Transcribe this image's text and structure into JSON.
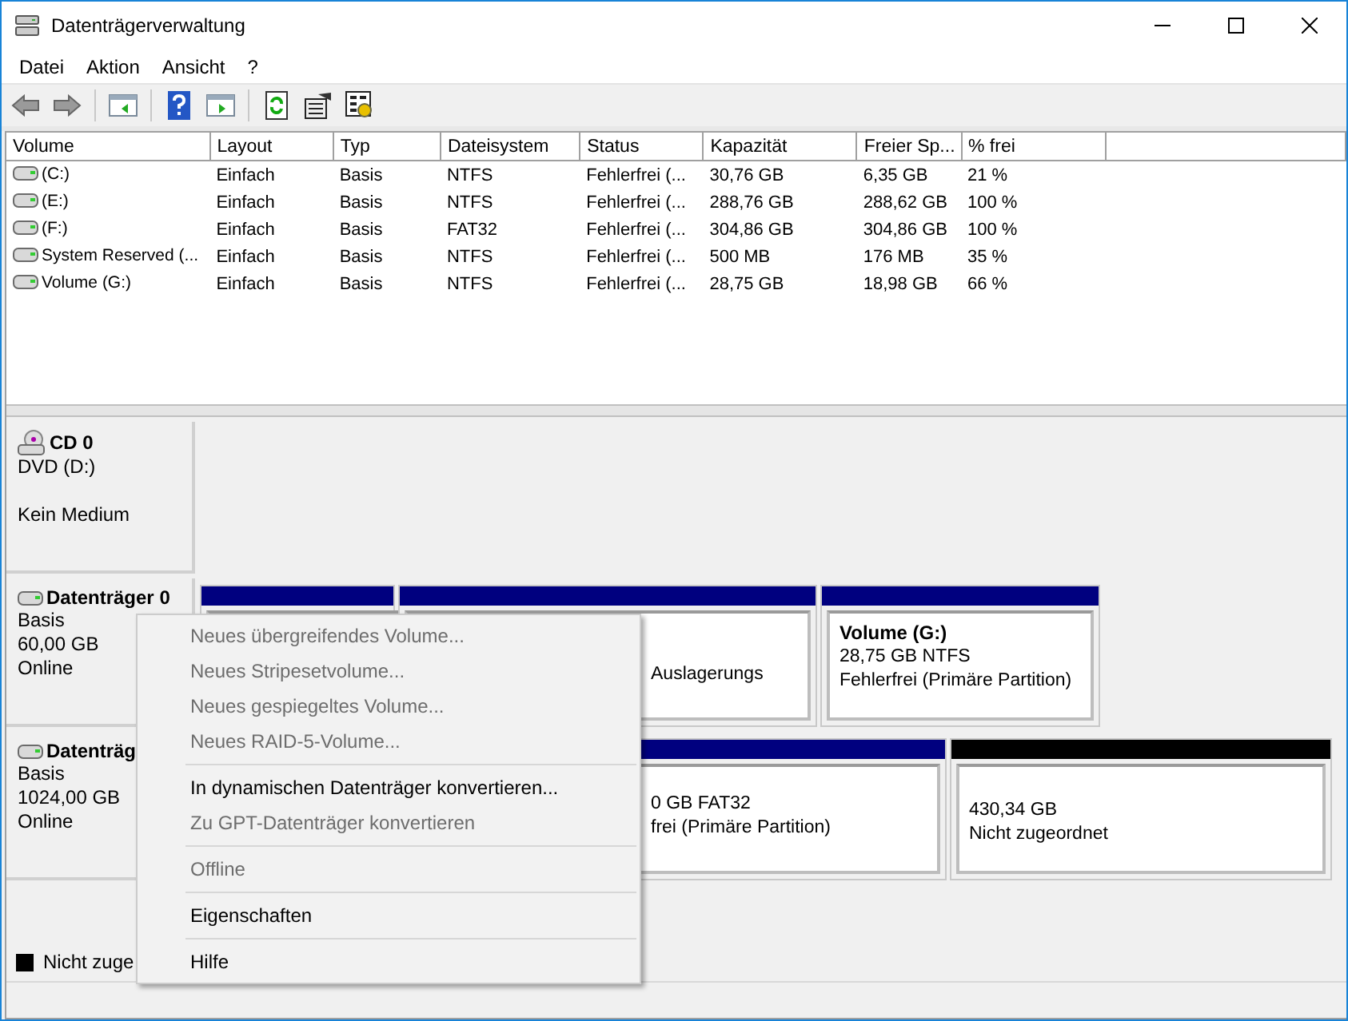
{
  "window": {
    "title": "Datenträgerverwaltung"
  },
  "menu_bar": [
    "Datei",
    "Aktion",
    "Ansicht",
    "?"
  ],
  "table": {
    "columns": [
      "Volume",
      "Layout",
      "Typ",
      "Dateisystem",
      "Status",
      "Kapazität",
      "Freier Sp...",
      "% frei"
    ],
    "rows": [
      {
        "cells": [
          "(C:)",
          "Einfach",
          "Basis",
          "NTFS",
          "Fehlerfrei (...",
          "30,76 GB",
          "6,35 GB",
          "21 %"
        ]
      },
      {
        "cells": [
          "(E:)",
          "Einfach",
          "Basis",
          "NTFS",
          "Fehlerfrei (...",
          "288,76 GB",
          "288,62 GB",
          "100 %"
        ]
      },
      {
        "cells": [
          "(F:)",
          "Einfach",
          "Basis",
          "FAT32",
          "Fehlerfrei (...",
          "304,86 GB",
          "304,86 GB",
          "100 %"
        ]
      },
      {
        "cells": [
          "System Reserved (...",
          "Einfach",
          "Basis",
          "NTFS",
          "Fehlerfrei (...",
          "500 MB",
          "176 MB",
          "35 %"
        ]
      },
      {
        "cells": [
          "Volume (G:)",
          "Einfach",
          "Basis",
          "NTFS",
          "Fehlerfrei (...",
          "28,75 GB",
          "18,98 GB",
          "66 %"
        ]
      }
    ]
  },
  "disks": [
    {
      "kind": "cd",
      "name": "CD 0",
      "type": "DVD (D:)",
      "status": "Kein Medium"
    },
    {
      "kind": "disk",
      "name": "Datenträger 0",
      "type": "Basis",
      "size": "60,00 GB",
      "status": "Online",
      "partitions": [
        {
          "kind": "primary",
          "covered": true
        },
        {
          "kind": "primary",
          "covered": true,
          "lines": [
            "Auslagerungs"
          ]
        },
        {
          "kind": "primary",
          "covered": false,
          "title": "Volume  (G:)",
          "lines": [
            "28,75 GB NTFS",
            "Fehlerfrei (Primäre Partition)"
          ]
        }
      ]
    },
    {
      "kind": "disk",
      "name": "Datenträg",
      "type": "Basis",
      "size": "1024,00 GB",
      "status": "Online",
      "partitions": [
        {
          "kind": "primary",
          "covered": true,
          "lines": [
            "0 GB FAT32",
            "frei (Primäre Partition)"
          ]
        },
        {
          "kind": "unallocated",
          "covered": false,
          "lines": [
            "430,34 GB",
            "Nicht zugeordnet"
          ]
        }
      ]
    }
  ],
  "legend": [
    {
      "label": "Nicht zuge",
      "color": "#000000"
    }
  ],
  "context_menu": [
    {
      "kind": "item",
      "label": "Neues übergreifendes Volume...",
      "disabled": true
    },
    {
      "kind": "item",
      "label": "Neues Stripesetvolume...",
      "disabled": true
    },
    {
      "kind": "item",
      "label": "Neues gespiegeltes Volume...",
      "disabled": true
    },
    {
      "kind": "item",
      "label": "Neues RAID-5-Volume...",
      "disabled": true
    },
    {
      "kind": "separator"
    },
    {
      "kind": "item",
      "label": "In dynamischen Datenträger konvertieren...",
      "disabled": false
    },
    {
      "kind": "item",
      "label": "Zu GPT-Datenträger konvertieren",
      "disabled": true
    },
    {
      "kind": "separator"
    },
    {
      "kind": "item",
      "label": "Offline",
      "disabled": true
    },
    {
      "kind": "separator"
    },
    {
      "kind": "item",
      "label": "Eigenschaften",
      "disabled": false
    },
    {
      "kind": "separator"
    },
    {
      "kind": "item",
      "label": "Hilfe",
      "disabled": false
    }
  ]
}
